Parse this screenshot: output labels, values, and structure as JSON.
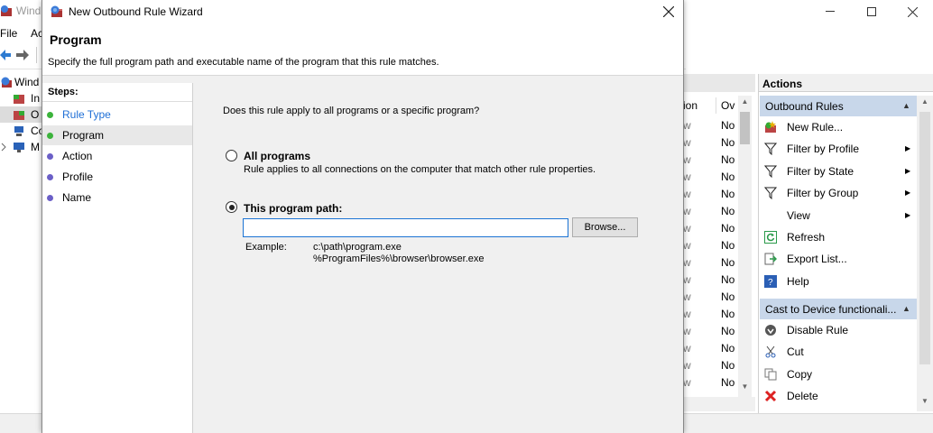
{
  "background_window": {
    "title": "Wind",
    "menu": [
      "File",
      "Ac"
    ],
    "tree": [
      {
        "label": "Wind",
        "icon": "firewall-icon"
      },
      {
        "label": "In",
        "icon": "inbound-rules-icon"
      },
      {
        "label": "O",
        "icon": "outbound-rules-icon"
      },
      {
        "label": "Co",
        "icon": "connection-security-icon"
      },
      {
        "label": "M",
        "icon": "monitoring-icon"
      }
    ],
    "list": {
      "columns": [
        "ion",
        "Ov"
      ],
      "rows": [
        {
          "c1": "w",
          "c2": "No"
        },
        {
          "c1": "w",
          "c2": "No"
        },
        {
          "c1": "w",
          "c2": "No"
        },
        {
          "c1": "w",
          "c2": "No"
        },
        {
          "c1": "w",
          "c2": "No"
        },
        {
          "c1": "w",
          "c2": "No"
        },
        {
          "c1": "w",
          "c2": "No"
        },
        {
          "c1": "w",
          "c2": "No"
        },
        {
          "c1": "w",
          "c2": "No"
        },
        {
          "c1": "w",
          "c2": "No"
        },
        {
          "c1": "w",
          "c2": "No"
        },
        {
          "c1": "w",
          "c2": "No"
        },
        {
          "c1": "w",
          "c2": "No"
        },
        {
          "c1": "w",
          "c2": "No"
        },
        {
          "c1": "w",
          "c2": "No"
        },
        {
          "c1": "w",
          "c2": "No"
        }
      ]
    },
    "actions": {
      "header": "Actions",
      "section1": "Outbound Rules",
      "section1_items": [
        {
          "label": "New Rule...",
          "icon": "new-rule-icon",
          "submenu": false
        },
        {
          "label": "Filter by Profile",
          "icon": "filter-icon",
          "submenu": true
        },
        {
          "label": "Filter by State",
          "icon": "filter-icon",
          "submenu": true
        },
        {
          "label": "Filter by Group",
          "icon": "filter-icon",
          "submenu": true
        },
        {
          "label": "View",
          "icon": "",
          "submenu": true
        },
        {
          "label": "Refresh",
          "icon": "refresh-icon",
          "submenu": false
        },
        {
          "label": "Export List...",
          "icon": "export-icon",
          "submenu": false
        },
        {
          "label": "Help",
          "icon": "help-icon",
          "submenu": false
        }
      ],
      "section2": "Cast to Device functionali...",
      "section2_items": [
        {
          "label": "Disable Rule",
          "icon": "disable-icon",
          "submenu": false
        },
        {
          "label": "Cut",
          "icon": "cut-icon",
          "submenu": false
        },
        {
          "label": "Copy",
          "icon": "copy-icon",
          "submenu": false
        },
        {
          "label": "Delete",
          "icon": "delete-icon",
          "submenu": false
        }
      ]
    }
  },
  "wizard": {
    "title": "New Outbound Rule Wizard",
    "page_title": "Program",
    "page_description": "Specify the full program path and executable name of the program that this rule matches.",
    "steps_title": "Steps:",
    "steps": [
      {
        "label": "Rule Type",
        "status": "done",
        "link": true
      },
      {
        "label": "Program",
        "status": "done",
        "current": true
      },
      {
        "label": "Action",
        "status": "todo"
      },
      {
        "label": "Profile",
        "status": "todo"
      },
      {
        "label": "Name",
        "status": "todo"
      }
    ],
    "question": "Does this rule apply to all programs or a specific program?",
    "option_all": {
      "label": "All programs",
      "description": "Rule applies to all connections on the computer that match other rule properties.",
      "selected": false
    },
    "option_path": {
      "label": "This program path:",
      "selected": true,
      "value": ""
    },
    "browse_label": "Browse...",
    "example_label": "Example:",
    "example_lines": [
      "c:\\path\\program.exe",
      "%ProgramFiles%\\browser\\browser.exe"
    ]
  },
  "colors": {
    "accent": "#1b74d4",
    "link": "#1f6fd6",
    "section_bg": "#c8d7ea",
    "step_done": "#3cb33c",
    "step_todo": "#6b5fc7"
  }
}
